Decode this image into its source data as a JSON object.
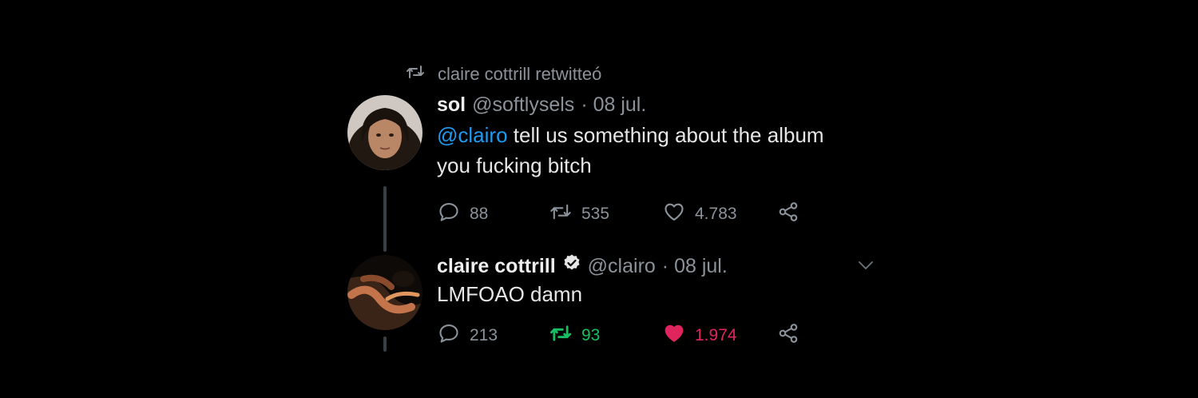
{
  "retweet_context": {
    "text": "claire cottrill retwitteó"
  },
  "tweets": [
    {
      "name": "sol",
      "handle": "@softlysels",
      "date": "· 08 jul.",
      "mention": "@clairo",
      "text_line1": "tell us something about the album",
      "text_line2": "you fucking bitch",
      "replies": "88",
      "retweets": "535",
      "likes": "4.783"
    },
    {
      "name": "claire cottrill",
      "handle": "@clairo",
      "date": "· 08 jul.",
      "text": "LMFOAO damn",
      "replies": "213",
      "retweets": "93",
      "likes": "1.974",
      "retweeted": true,
      "liked": true
    }
  ],
  "colors": {
    "background": "#000000",
    "mention": "#1d9bf0",
    "retweeted": "#17bf63",
    "liked": "#e0245e",
    "muted": "#8b9299"
  },
  "icons": [
    "retweet-icon",
    "reply-icon",
    "like-icon",
    "share-icon",
    "verified-icon",
    "chevron-down-icon"
  ]
}
